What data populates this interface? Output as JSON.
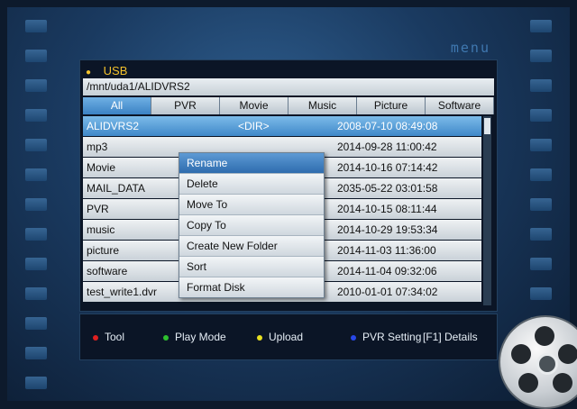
{
  "brand": "menu",
  "device": {
    "label": "USB"
  },
  "path": "/mnt/uda1/ALIDVRS2",
  "tabs": [
    {
      "label": "All",
      "active": true
    },
    {
      "label": "PVR"
    },
    {
      "label": "Movie"
    },
    {
      "label": "Music"
    },
    {
      "label": "Picture"
    },
    {
      "label": "Software"
    }
  ],
  "files": [
    {
      "name": "ALIDVRS2",
      "type": "<DIR>",
      "date": "2008-07-10 08:49:08",
      "selected": true
    },
    {
      "name": "mp3",
      "type": "",
      "date": "2014-09-28 11:00:42"
    },
    {
      "name": "Movie",
      "type": "",
      "date": "2014-10-16 07:14:42"
    },
    {
      "name": "MAIL_DATA",
      "type": "",
      "date": "2035-05-22 03:01:58"
    },
    {
      "name": "PVR",
      "type": "",
      "date": "2014-10-15 08:11:44"
    },
    {
      "name": "music",
      "type": "",
      "date": "2014-10-29 19:53:34"
    },
    {
      "name": "picture",
      "type": "",
      "date": "2014-11-03 11:36:00"
    },
    {
      "name": "software",
      "type": "",
      "date": "2014-11-04 09:32:06"
    },
    {
      "name": "test_write1.dvr",
      "type": "",
      "date": "2010-01-01 07:34:02"
    }
  ],
  "context_menu": {
    "items": [
      {
        "label": "Rename",
        "selected": true
      },
      {
        "label": "Delete"
      },
      {
        "label": "Move To"
      },
      {
        "label": "Copy To"
      },
      {
        "label": "Create New Folder"
      },
      {
        "label": "Sort"
      },
      {
        "label": "Format Disk"
      }
    ]
  },
  "help": [
    {
      "color": "#e02020",
      "label": "Tool",
      "icon": "red-dot-icon"
    },
    {
      "color": "#2ec02e",
      "label": "Play Mode",
      "icon": "green-dot-icon"
    },
    {
      "color": "#e8e020",
      "label": "Upload",
      "icon": "yellow-dot-icon"
    },
    {
      "color": "#2848e8",
      "label": "PVR Setting",
      "icon": "blue-dot-icon"
    },
    {
      "label": "[F1]  Details"
    }
  ],
  "colors": {
    "accent": "#3f88c9",
    "device_label": "#f2c12c"
  }
}
